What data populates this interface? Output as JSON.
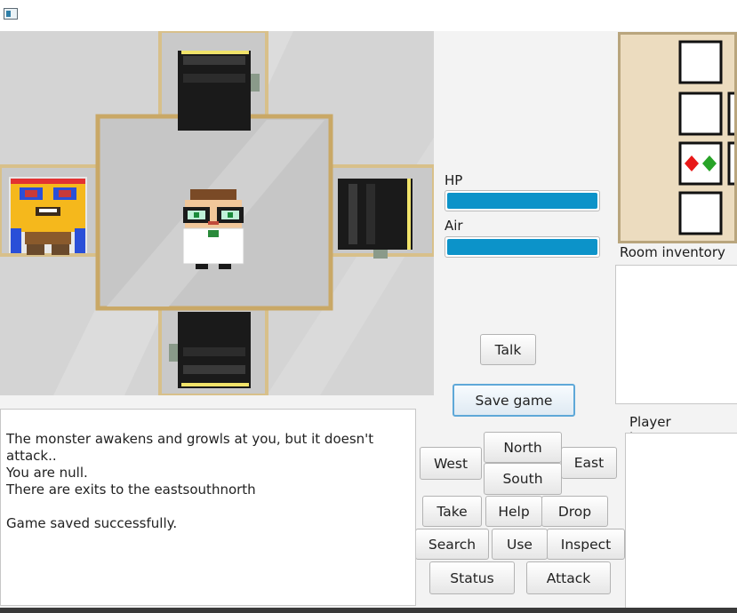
{
  "window": {
    "icon": "app-window-icon"
  },
  "stats": {
    "hp": {
      "label": "HP",
      "value": 1.0
    },
    "air": {
      "label": "Air",
      "value": 1.0
    }
  },
  "buttons": {
    "talk": "Talk",
    "save": "Save game",
    "north": "North",
    "west": "West",
    "east": "East",
    "south": "South",
    "take": "Take",
    "help": "Help",
    "drop": "Drop",
    "search": "Search",
    "use": "Use",
    "inspect": "Inspect",
    "status": "Status",
    "attack": "Attack"
  },
  "room_inventory": {
    "label": "Room inventory"
  },
  "player_inventory": {
    "label": "Player inventory"
  },
  "log": {
    "text": "The monster awakens and growls at you, but it doesn't attack..\nYou are null.\nThere are exits to the eastsouthnorth\n\nGame saved successfully."
  },
  "colors": {
    "accent": "#0c93c9",
    "focus": "#5ea8d8"
  }
}
